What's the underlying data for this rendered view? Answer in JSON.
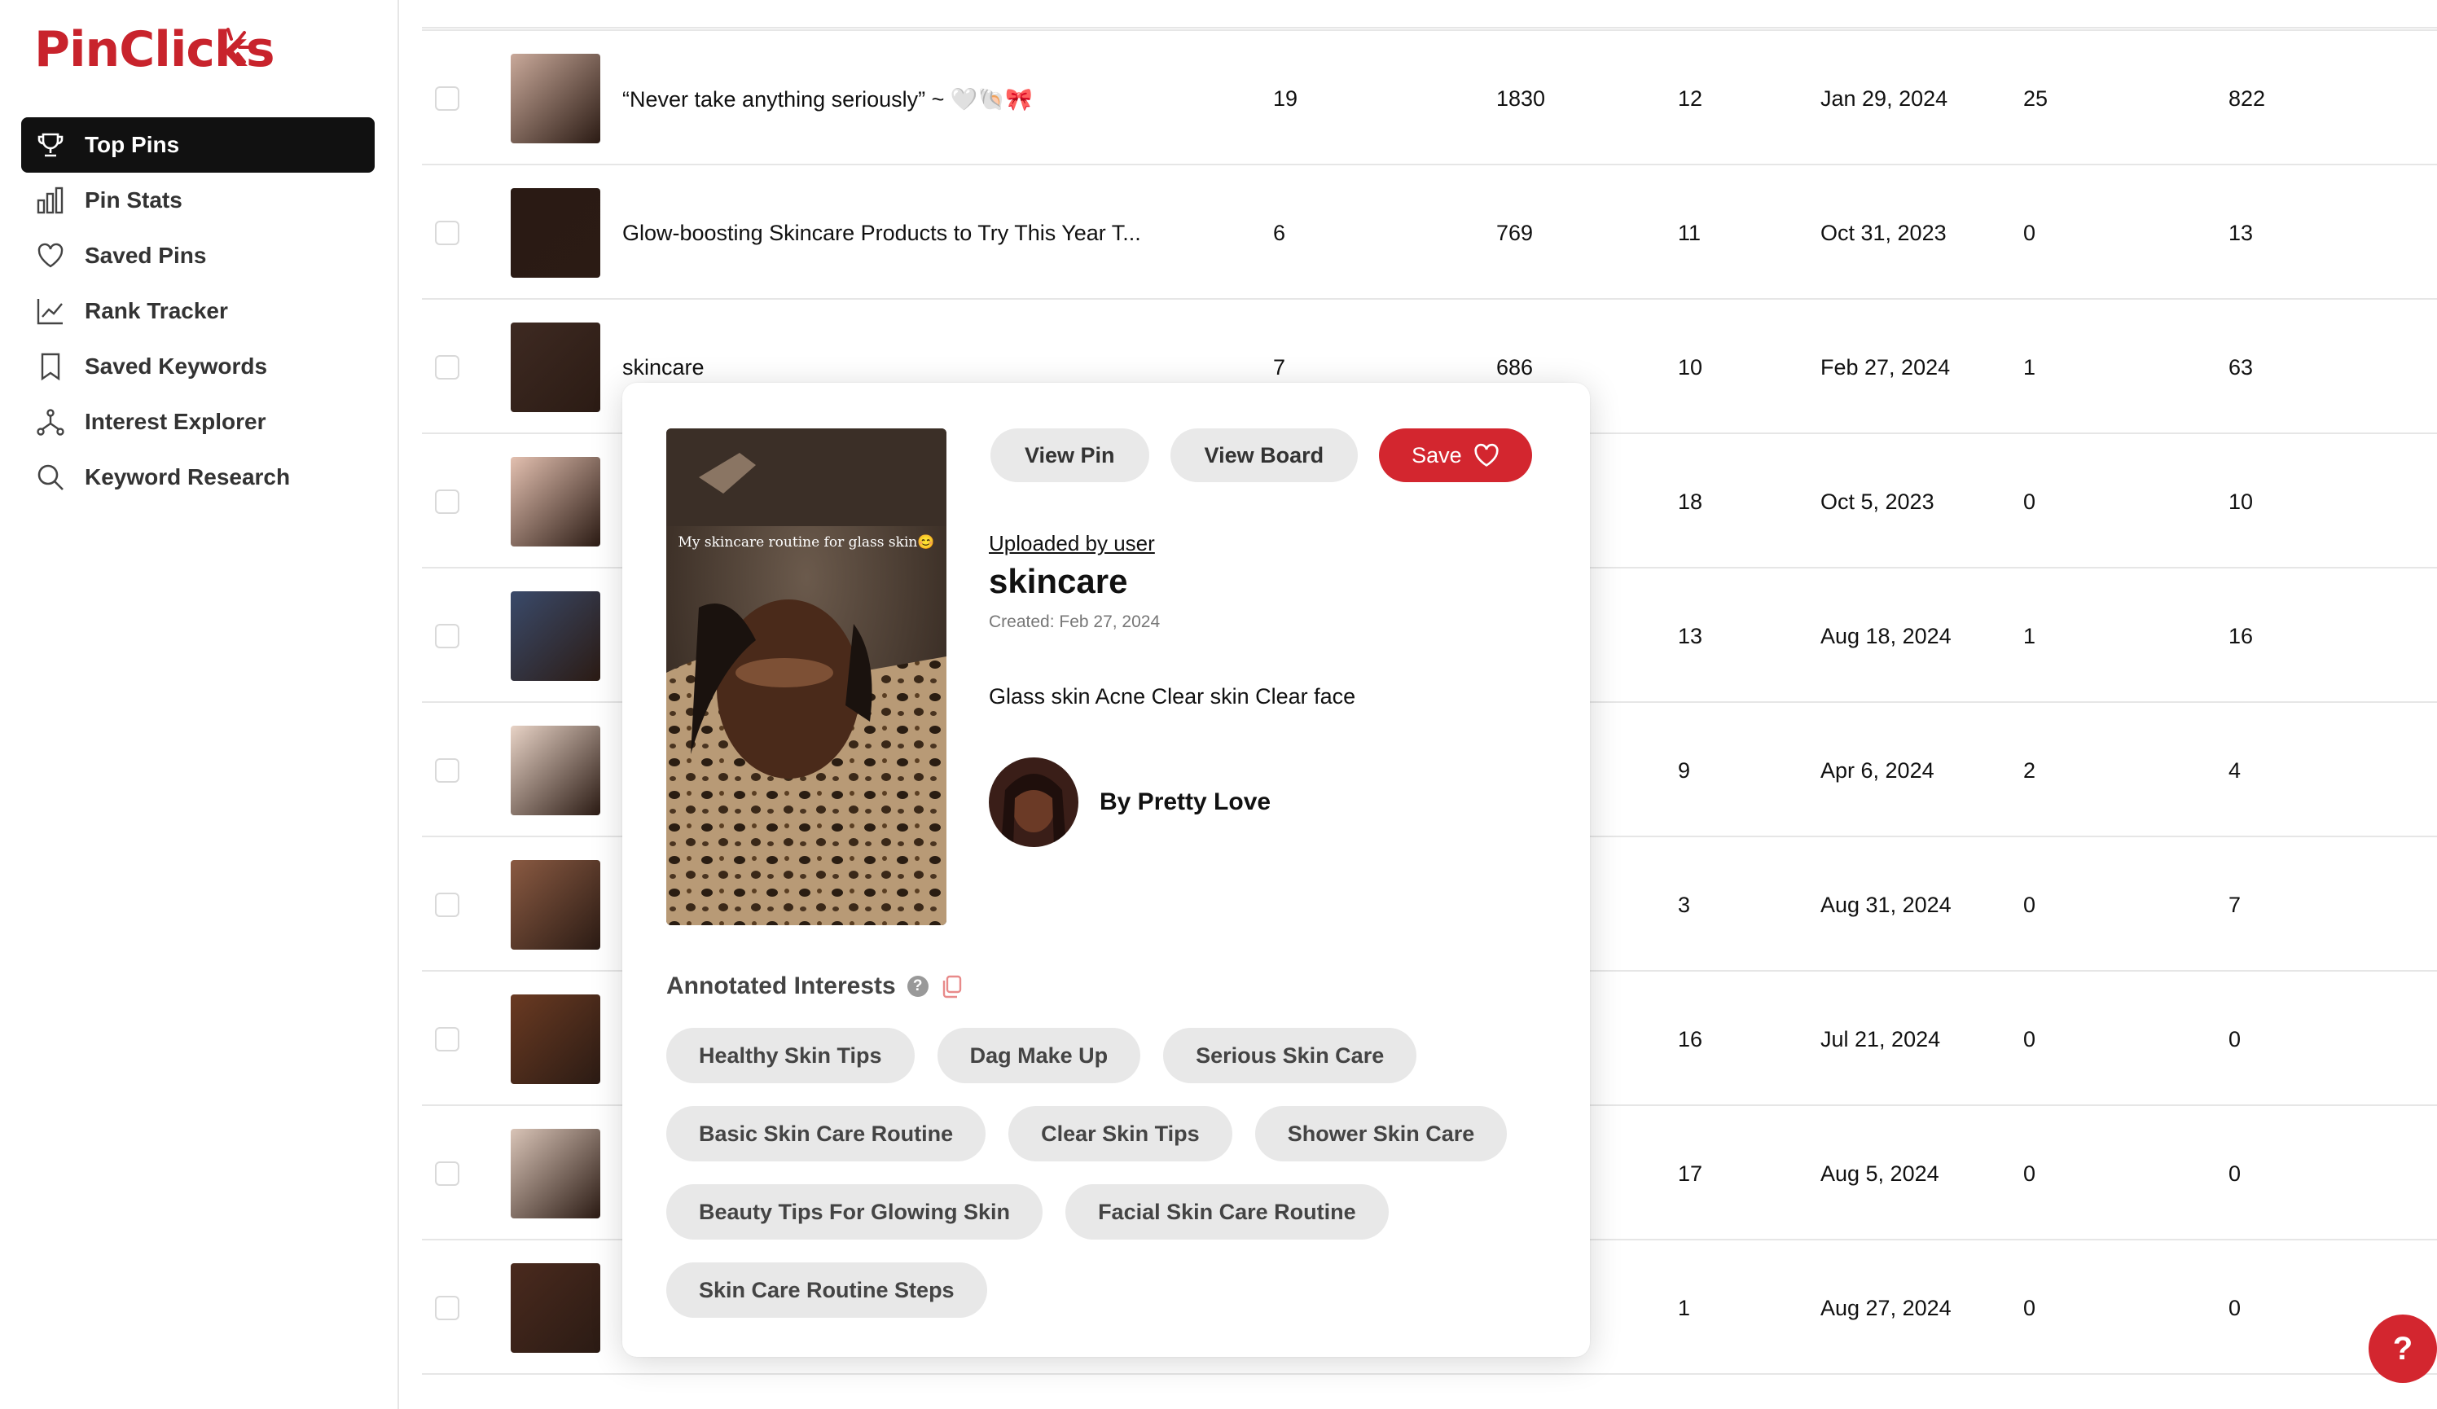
{
  "brand": {
    "logo_text": "PinClicks",
    "accent": "#d3262f"
  },
  "sidebar": {
    "items": [
      {
        "label": "Top Pins",
        "icon": "trophy-icon",
        "active": true
      },
      {
        "label": "Pin Stats",
        "icon": "bar-chart-icon"
      },
      {
        "label": "Saved Pins",
        "icon": "heart-icon"
      },
      {
        "label": "Rank Tracker",
        "icon": "line-chart-icon"
      },
      {
        "label": "Saved Keywords",
        "icon": "bookmark-icon"
      },
      {
        "label": "Interest Explorer",
        "icon": "network-icon"
      },
      {
        "label": "Keyword Research",
        "icon": "search-icon"
      }
    ]
  },
  "table": {
    "rows": [
      {
        "title": "“Never take anything seriously” ~ 🤍🐚🎀",
        "c1": "19",
        "c2": "1830",
        "c3": "12",
        "date": "Jan 29, 2024",
        "c4": "25",
        "c5": "822"
      },
      {
        "title": "Glow-boosting Skincare Products to Try This Year T...",
        "c1": "6",
        "c2": "769",
        "c3": "11",
        "date": "Oct 31, 2023",
        "c4": "0",
        "c5": "13"
      },
      {
        "title": "skincare",
        "c1": "7",
        "c2": "686",
        "c3": "10",
        "date": "Feb 27, 2024",
        "c4": "1",
        "c5": "63"
      },
      {
        "title": "",
        "c1": "",
        "c2": "",
        "c3": "18",
        "date": "Oct 5, 2023",
        "c4": "0",
        "c5": "10"
      },
      {
        "title": "",
        "c1": "",
        "c2": "",
        "c3": "13",
        "date": "Aug 18, 2024",
        "c4": "1",
        "c5": "16"
      },
      {
        "title": "",
        "c1": "",
        "c2": "",
        "c3": "9",
        "date": "Apr 6, 2024",
        "c4": "2",
        "c5": "4"
      },
      {
        "title": "",
        "c1": "",
        "c2": "",
        "c3": "3",
        "date": "Aug 31, 2024",
        "c4": "0",
        "c5": "7"
      },
      {
        "title": "",
        "c1": "",
        "c2": "",
        "c3": "16",
        "date": "Jul 21, 2024",
        "c4": "0",
        "c5": "0"
      },
      {
        "title": "",
        "c1": "",
        "c2": "",
        "c3": "17",
        "date": "Aug 5, 2024",
        "c4": "0",
        "c5": "0"
      },
      {
        "title": "",
        "c1": "",
        "c2": "",
        "c3": "1",
        "date": "Aug 27, 2024",
        "c4": "0",
        "c5": "0"
      }
    ]
  },
  "popup": {
    "image_caption": "My skincare routine for glass skin😊",
    "view_pin": "View Pin",
    "view_board": "View Board",
    "save": "Save",
    "uploaded_by": "Uploaded by user",
    "title": "skincare",
    "created": "Created: Feb 27, 2024",
    "description": "Glass skin Acne Clear skin Clear face",
    "author": "By Pretty Love",
    "annotated_heading": "Annotated Interests",
    "help_glyph": "?",
    "tag_rows": [
      [
        "Healthy Skin Tips",
        "Dag Make Up",
        "Serious Skin Care"
      ],
      [
        "Basic Skin Care Routine",
        "Clear Skin Tips",
        "Shower Skin Care"
      ],
      [
        "Beauty Tips For Glowing Skin",
        "Facial Skin Care Routine"
      ],
      [
        "Skin Care Routine Steps"
      ]
    ]
  },
  "help_button": "?"
}
